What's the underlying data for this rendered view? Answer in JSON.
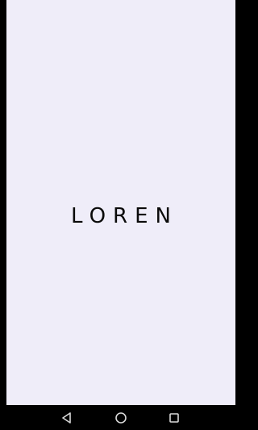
{
  "splash": {
    "brand_name": "LOREN"
  },
  "navigation_bar": {
    "icons": [
      "back-icon",
      "home-icon",
      "recents-icon"
    ]
  },
  "colors": {
    "surface": "#efedf9",
    "frame": "#000000",
    "brand_text": "#0a0a0a",
    "nav_icon": "#d9d9d9"
  }
}
